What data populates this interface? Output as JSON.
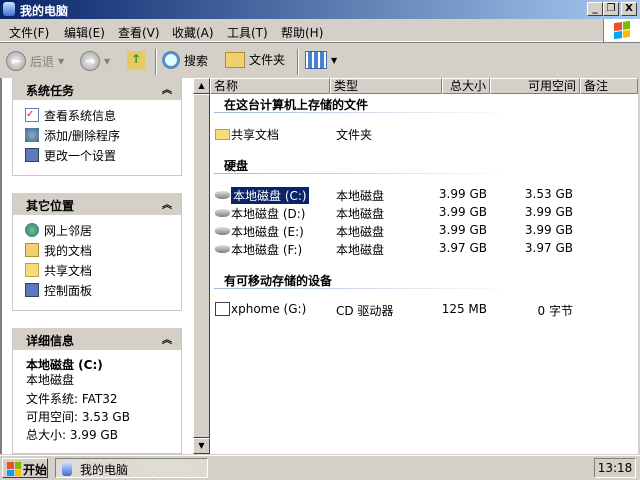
{
  "window": {
    "title": "我的电脑",
    "controls": {
      "minimize": "_",
      "restore": "❐",
      "close": "X"
    }
  },
  "menu": [
    "文件(F)",
    "编辑(E)",
    "查看(V)",
    "收藏(A)",
    "工具(T)",
    "帮助(H)"
  ],
  "toolbar": {
    "back": "后退",
    "search": "搜索",
    "folders": "文件夹"
  },
  "left": {
    "system_tasks": {
      "title": "系统任务",
      "items": [
        "查看系统信息",
        "添加/删除程序",
        "更改一个设置"
      ]
    },
    "other_places": {
      "title": "其它位置",
      "items": [
        "网上邻居",
        "我的文档",
        "共享文档",
        "控制面板"
      ]
    },
    "details": {
      "title": "详细信息",
      "name": "本地磁盘 (C:)",
      "type": "本地磁盘",
      "fs": "文件系统: FAT32",
      "free": "可用空间: 3.53 GB",
      "total": "总大小: 3.99 GB"
    }
  },
  "columns": [
    "名称",
    "类型",
    "总大小",
    "可用空间",
    "备注"
  ],
  "groups": [
    {
      "title": "在这台计算机上存储的文件",
      "rows": [
        {
          "name": "共享文档",
          "type": "文件夹",
          "total": "",
          "free": "",
          "icon": "folder-icon"
        }
      ]
    },
    {
      "title": "硬盘",
      "rows": [
        {
          "name": "本地磁盘 (C:)",
          "type": "本地磁盘",
          "total": "3.99 GB",
          "free": "3.53 GB",
          "icon": "hard-disk-icon",
          "selected": true
        },
        {
          "name": "本地磁盘 (D:)",
          "type": "本地磁盘",
          "total": "3.99 GB",
          "free": "3.99 GB",
          "icon": "hard-disk-icon"
        },
        {
          "name": "本地磁盘 (E:)",
          "type": "本地磁盘",
          "total": "3.99 GB",
          "free": "3.99 GB",
          "icon": "hard-disk-icon"
        },
        {
          "name": "本地磁盘 (F:)",
          "type": "本地磁盘",
          "total": "3.97 GB",
          "free": "3.97 GB",
          "icon": "hard-disk-icon"
        }
      ]
    },
    {
      "title": "有可移动存储的设备",
      "rows": [
        {
          "name": "xphome (G:)",
          "type": "CD 驱动器",
          "total": "125 MB",
          "free": "0 字节",
          "icon": "cd-drive-icon"
        }
      ]
    }
  ],
  "taskbar": {
    "start": "开始",
    "task": "我的电脑",
    "clock": "13:18"
  }
}
